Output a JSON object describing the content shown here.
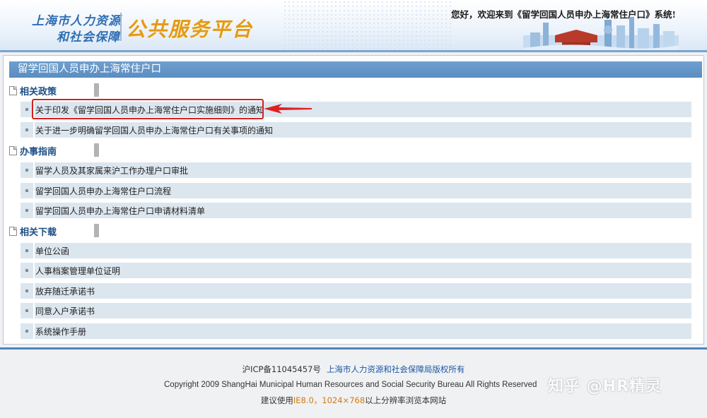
{
  "header": {
    "logo_line1": "上海市人力资源",
    "logo_line2": "和社会保障",
    "logo_main": "公共服务平台",
    "welcome": "您好，欢迎来到《留学回国人员申办上海常住户口》系统!"
  },
  "panel": {
    "title": "留学回国人员申办上海常住户口",
    "sections": [
      {
        "label": "相关政策",
        "items": [
          "关于印发《留学回国人员申办上海常住户口实施细则》的通知",
          "关于进一步明确留学回国人员申办上海常住户口有关事项的通知"
        ]
      },
      {
        "label": "办事指南",
        "items": [
          "留学人员及其家属来沪工作办理户口审批",
          "留学回国人员申办上海常住户口流程",
          "留学回国人员申办上海常住户口申请材料清单"
        ]
      },
      {
        "label": "相关下载",
        "items": [
          "单位公函",
          "人事档案管理单位证明",
          "放弃随迁承诺书",
          "同意入户承诺书",
          "系统操作手册"
        ]
      }
    ]
  },
  "footer": {
    "icp": "沪ICP备11045457号",
    "rights_link": "上海市人力资源和社会保障局版权所有",
    "copyright": "Copyright 2009 ShangHai Municipal Human Resources and Social Security Bureau All Rights Reserved",
    "browser_prefix": "建议使用",
    "browser_highlight": "IE8.0，1024×768",
    "browser_suffix": "以上分辨率浏览本网站"
  },
  "watermark": "知乎 @HR精灵",
  "colors": {
    "accent": "#5a8dc1",
    "item_bg": "#dce6ef",
    "highlight_border": "#d62020",
    "logo_orange": "#e39a18"
  }
}
